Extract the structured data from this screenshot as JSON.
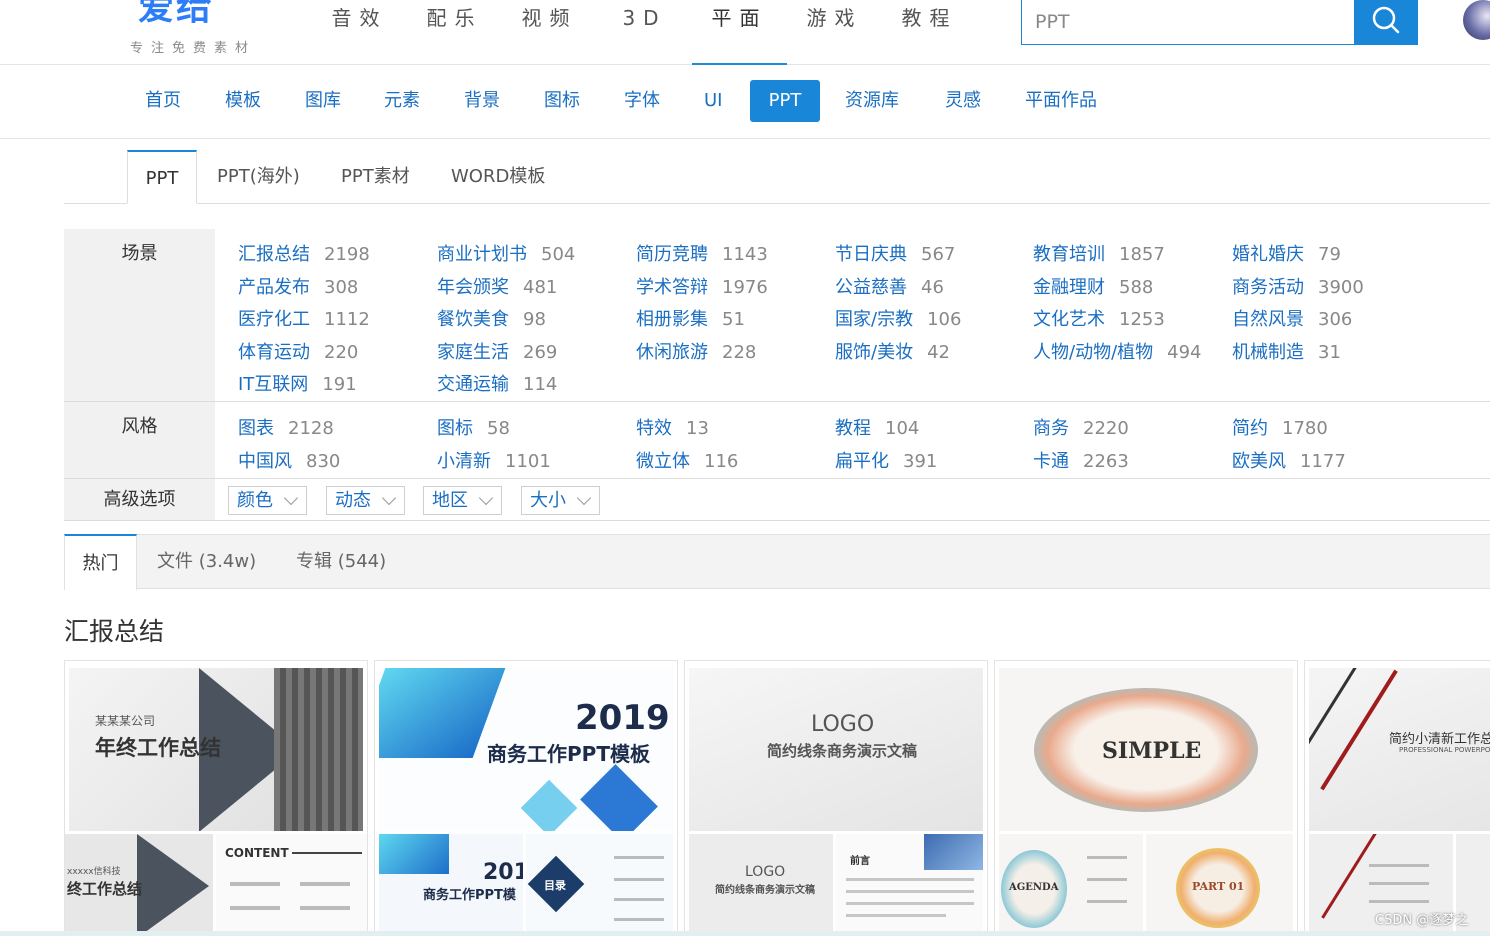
{
  "header": {
    "logo_text": "爱给",
    "tagline": "专注免费素材",
    "nav": [
      "音效",
      "配乐",
      "视频",
      "3D",
      "平面",
      "游戏",
      "教程"
    ],
    "nav_active": "平面",
    "search_value": "PPT"
  },
  "category_nav": {
    "items": [
      "首页",
      "模板",
      "图库",
      "元素",
      "背景",
      "图标",
      "字体",
      "UI",
      "PPT",
      "资源库",
      "灵感",
      "平面作品"
    ],
    "active": "PPT"
  },
  "sub_tabs": {
    "items": [
      "PPT",
      "PPT(海外)",
      "PPT素材",
      "WORD模板"
    ],
    "active": "PPT"
  },
  "filters": {
    "scene": {
      "label": "场景",
      "items": [
        {
          "name": "汇报总结",
          "count": "2198"
        },
        {
          "name": "商业计划书",
          "count": "504"
        },
        {
          "name": "简历竞聘",
          "count": "1143"
        },
        {
          "name": "节日庆典",
          "count": "567"
        },
        {
          "name": "教育培训",
          "count": "1857"
        },
        {
          "name": "婚礼婚庆",
          "count": "79"
        },
        {
          "name": "产品发布",
          "count": "308"
        },
        {
          "name": "年会颁奖",
          "count": "481"
        },
        {
          "name": "学术答辩",
          "count": "1976"
        },
        {
          "name": "公益慈善",
          "count": "46"
        },
        {
          "name": "金融理财",
          "count": "588"
        },
        {
          "name": "商务活动",
          "count": "3900"
        },
        {
          "name": "医疗化工",
          "count": "1112"
        },
        {
          "name": "餐饮美食",
          "count": "98"
        },
        {
          "name": "相册影集",
          "count": "51"
        },
        {
          "name": "国家/宗教",
          "count": "106"
        },
        {
          "name": "文化艺术",
          "count": "1253"
        },
        {
          "name": "自然风景",
          "count": "306"
        },
        {
          "name": "体育运动",
          "count": "220"
        },
        {
          "name": "家庭生活",
          "count": "269"
        },
        {
          "name": "休闲旅游",
          "count": "228"
        },
        {
          "name": "服饰/美妆",
          "count": "42"
        },
        {
          "name": "人物/动物/植物",
          "count": "494"
        },
        {
          "name": "机械制造",
          "count": "31"
        },
        {
          "name": "IT互联网",
          "count": "191"
        },
        {
          "name": "交通运输",
          "count": "114"
        }
      ]
    },
    "style": {
      "label": "风格",
      "items": [
        {
          "name": "图表",
          "count": "2128"
        },
        {
          "name": "图标",
          "count": "58"
        },
        {
          "name": "特效",
          "count": "13"
        },
        {
          "name": "教程",
          "count": "104"
        },
        {
          "name": "商务",
          "count": "2220"
        },
        {
          "name": "简约",
          "count": "1780"
        },
        {
          "name": "中国风",
          "count": "830"
        },
        {
          "name": "小清新",
          "count": "1101"
        },
        {
          "name": "微立体",
          "count": "116"
        },
        {
          "name": "扁平化",
          "count": "391"
        },
        {
          "name": "卡通",
          "count": "2263"
        },
        {
          "name": "欧美风",
          "count": "1177"
        }
      ]
    },
    "advanced": {
      "label": "高级选项",
      "dropdowns": [
        "颜色",
        "动态",
        "地区",
        "大小"
      ]
    }
  },
  "content_tabs": {
    "items": [
      "热门",
      "文件 (3.4w)",
      "专辑 (544)"
    ],
    "active": "热门"
  },
  "section_title": "汇报总结",
  "cards": [
    {
      "main_sub": "某某某公司",
      "main_title": "年终工作总结",
      "tile_a": "xxxxx信科技",
      "tile_a2": "终工作总结",
      "tile_b": "CONTENT"
    },
    {
      "main_year": "2019",
      "main_title": "商务工作PPT模板",
      "tile_a": "201",
      "tile_a2": "商务工作PPT模",
      "tile_b": "目录"
    },
    {
      "main_logo": "LOGO",
      "main_title": "简约线条商务演示文稿",
      "tile_a": "LOGO",
      "tile_a2": "简约线条商务演示文稿",
      "tile_b": "前言"
    },
    {
      "main_title": "SIMPLE",
      "tile_a": "AGENDA",
      "tile_b": "PART 01"
    },
    {
      "main_title": "简约小清新工作总结",
      "main_sub": "PROFESSIONAL POWERPO"
    }
  ],
  "watermark": "CSDN @逐梦之",
  "colors": {
    "accent": "#1a86d8",
    "link": "#1b6fc2",
    "count": "#888888",
    "label_bg": "#f1f1f1"
  }
}
